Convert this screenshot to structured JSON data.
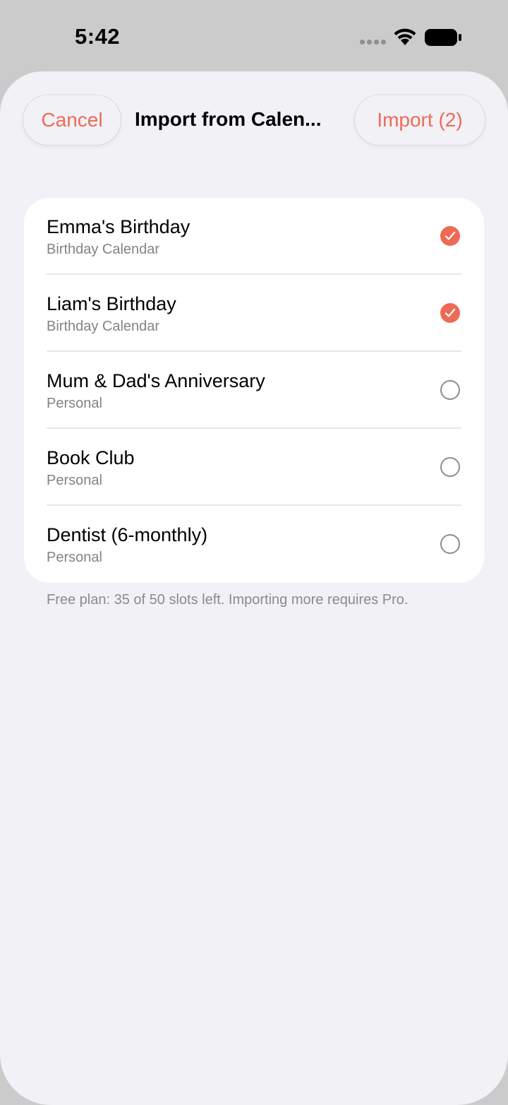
{
  "status_bar": {
    "time": "5:42"
  },
  "header": {
    "cancel_label": "Cancel",
    "title": "Import from Calen...",
    "import_label": "Import (2)"
  },
  "items": [
    {
      "title": "Emma's Birthday",
      "subtitle": "Birthday Calendar",
      "selected": true
    },
    {
      "title": "Liam's Birthday",
      "subtitle": "Birthday Calendar",
      "selected": true
    },
    {
      "title": "Mum & Dad's Anniversary",
      "subtitle": "Personal",
      "selected": false
    },
    {
      "title": "Book Club",
      "subtitle": "Personal",
      "selected": false
    },
    {
      "title": "Dentist (6-monthly)",
      "subtitle": "Personal",
      "selected": false
    }
  ],
  "footnote": "Free plan: 35 of 50 slots left. Importing more requires Pro.",
  "colors": {
    "accent": "#ee6a55",
    "sheet_background": "#f1f1f6",
    "card_background": "#ffffff",
    "secondary_text": "#838388"
  },
  "icons": {
    "selected": "checkmark-circle-filled-icon",
    "unselected": "circle-outline-icon",
    "wifi": "wifi-icon",
    "battery": "battery-icon",
    "signal": "signal-dots-icon"
  }
}
